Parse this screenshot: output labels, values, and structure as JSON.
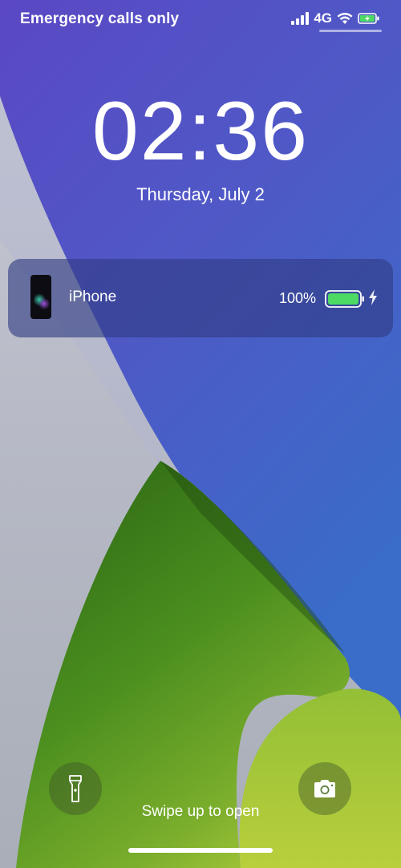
{
  "status_bar": {
    "carrier": "Emergency calls only",
    "network_type": "4G",
    "battery_charging": true
  },
  "lock_screen": {
    "time": "02:36",
    "date": "Thursday, July 2"
  },
  "battery_widget": {
    "device_name": "iPhone",
    "battery_percent": "100%",
    "battery_level": 1.0,
    "battery_color": "#4cd964"
  },
  "bottom": {
    "swipe_hint": "Swipe up to open",
    "left_button_icon": "flashlight-icon",
    "right_button_icon": "camera-icon"
  },
  "colors": {
    "wallpaper_blue": "#4a56c8",
    "wallpaper_green": "#4a8a1e",
    "wallpaper_grey": "#b9bcc7"
  }
}
